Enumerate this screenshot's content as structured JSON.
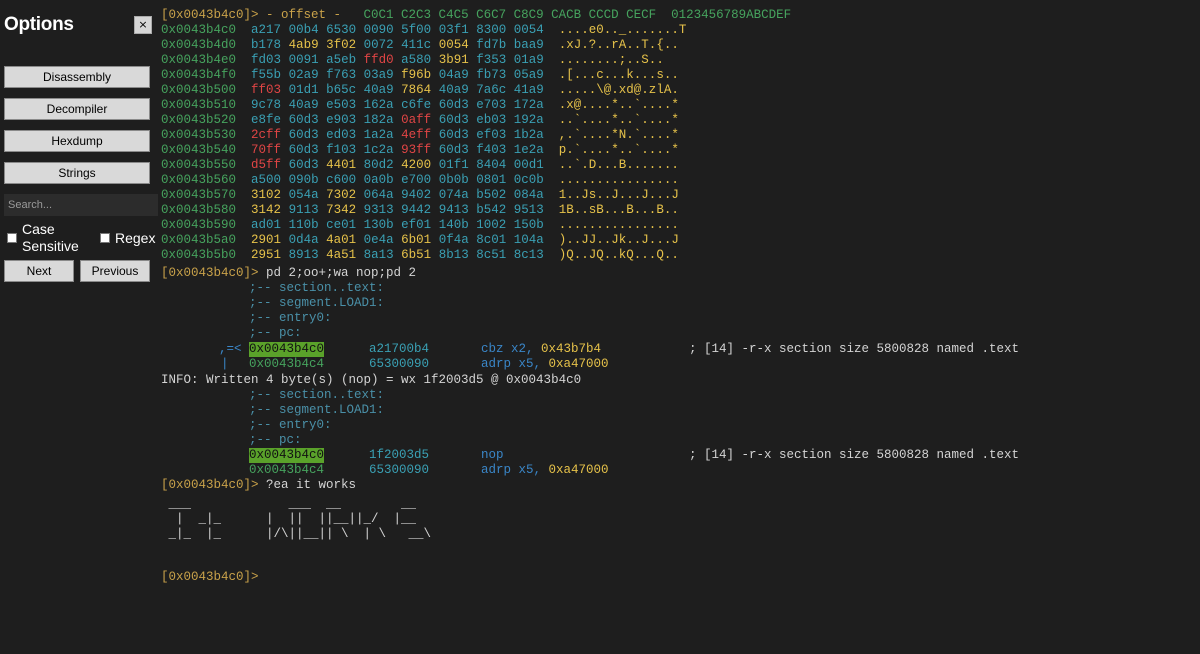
{
  "sidebar": {
    "title": "Options",
    "close_label": "×",
    "buttons": {
      "disassembly": "Disassembly",
      "decompiler": "Decompiler",
      "hexdump": "Hexdump",
      "strings": "Strings"
    },
    "search_placeholder": "Search...",
    "case_sensitive_line1": "Case",
    "case_sensitive_line2": "Sensitive",
    "regex": "Regex",
    "next": "Next",
    "previous": "Previous"
  },
  "terminal": {
    "hex_header": {
      "prompt": "[0x0043b4c0]>",
      "dash_offset": " - offset - ",
      "cols": "  C0C1 C2C3 C4C5 C6C7 C8C9 CACB CCCD CECF",
      "ascii_cols": "  0123456789ABCDEF"
    },
    "hex_rows": [
      {
        "addr": "0x0043b4c0",
        "w": [
          [
            "a217",
            "x"
          ],
          [
            "00b4",
            "m"
          ],
          [
            "6530",
            "x"
          ],
          [
            "0090",
            "x"
          ],
          [
            "5f00",
            "m"
          ],
          [
            "03f1",
            "x"
          ],
          [
            "8300",
            "x"
          ],
          [
            "0054",
            "m"
          ]
        ],
        "ascii": "....e0.._.......T"
      },
      {
        "addr": "0x0043b4d0",
        "w": [
          [
            "b178",
            "x"
          ],
          [
            "4ab9",
            "y"
          ],
          [
            "3f02",
            "y"
          ],
          [
            "0072",
            "x"
          ],
          [
            "411c",
            "x"
          ],
          [
            "0054",
            "y"
          ],
          [
            "fd7b",
            "x"
          ],
          [
            "baa9",
            "x"
          ]
        ],
        "ascii": ".xJ.?..rA..T.{.."
      },
      {
        "addr": "0x0043b4e0",
        "w": [
          [
            "fd03",
            "x"
          ],
          [
            "0091",
            "x"
          ],
          [
            "a5eb",
            "x"
          ],
          [
            "ffd0",
            "r"
          ],
          [
            "a580",
            "x"
          ],
          [
            "3b91",
            "y"
          ],
          [
            "f353",
            "x"
          ],
          [
            "01a9",
            "x"
          ]
        ],
        "ascii": "........;..S.."
      },
      {
        "addr": "0x0043b4f0",
        "w": [
          [
            "f55b",
            "x"
          ],
          [
            "02a9",
            "x"
          ],
          [
            "f763",
            "x"
          ],
          [
            "03a9",
            "x"
          ],
          [
            "f96b",
            "y"
          ],
          [
            "04a9",
            "x"
          ],
          [
            "fb73",
            "x"
          ],
          [
            "05a9",
            "x"
          ]
        ],
        "ascii": ".[...c...k...s.."
      },
      {
        "addr": "0x0043b500",
        "w": [
          [
            "ff03",
            "r"
          ],
          [
            "01d1",
            "x"
          ],
          [
            "b65c",
            "x"
          ],
          [
            "40a9",
            "x"
          ],
          [
            "7864",
            "y"
          ],
          [
            "40a9",
            "x"
          ],
          [
            "7a6c",
            "x"
          ],
          [
            "41a9",
            "x"
          ]
        ],
        "ascii": ".....\\@.xd@.zlA."
      },
      {
        "addr": "0x0043b510",
        "w": [
          [
            "9c78",
            "x"
          ],
          [
            "40a9",
            "x"
          ],
          [
            "e503",
            "x"
          ],
          [
            "162a",
            "x"
          ],
          [
            "c6fe",
            "x"
          ],
          [
            "60d3",
            "x"
          ],
          [
            "e703",
            "x"
          ],
          [
            "172a",
            "x"
          ]
        ],
        "ascii": ".x@....*..`....*"
      },
      {
        "addr": "0x0043b520",
        "w": [
          [
            "e8fe",
            "x"
          ],
          [
            "60d3",
            "x"
          ],
          [
            "e903",
            "x"
          ],
          [
            "182a",
            "x"
          ],
          [
            "0aff",
            "r"
          ],
          [
            "60d3",
            "x"
          ],
          [
            "eb03",
            "x"
          ],
          [
            "192a",
            "x"
          ]
        ],
        "ascii": "..`....*..`....*"
      },
      {
        "addr": "0x0043b530",
        "w": [
          [
            "2cff",
            "r"
          ],
          [
            "60d3",
            "x"
          ],
          [
            "ed03",
            "x"
          ],
          [
            "1a2a",
            "x"
          ],
          [
            "4eff",
            "r"
          ],
          [
            "60d3",
            "x"
          ],
          [
            "ef03",
            "x"
          ],
          [
            "1b2a",
            "x"
          ]
        ],
        "ascii": ",.`....*N.`....*"
      },
      {
        "addr": "0x0043b540",
        "w": [
          [
            "70ff",
            "r"
          ],
          [
            "60d3",
            "x"
          ],
          [
            "f103",
            "x"
          ],
          [
            "1c2a",
            "x"
          ],
          [
            "93ff",
            "r"
          ],
          [
            "60d3",
            "x"
          ],
          [
            "f403",
            "x"
          ],
          [
            "1e2a",
            "x"
          ]
        ],
        "ascii": "p.`....*..`....*"
      },
      {
        "addr": "0x0043b550",
        "w": [
          [
            "d5ff",
            "r"
          ],
          [
            "60d3",
            "x"
          ],
          [
            "4401",
            "y"
          ],
          [
            "80d2",
            "x"
          ],
          [
            "4200",
            "y"
          ],
          [
            "01f1",
            "x"
          ],
          [
            "8404",
            "x"
          ],
          [
            "00d1",
            "x"
          ]
        ],
        "ascii": "..`.D...B......."
      },
      {
        "addr": "0x0043b560",
        "w": [
          [
            "a500",
            "x"
          ],
          [
            "090b",
            "x"
          ],
          [
            "c600",
            "x"
          ],
          [
            "0a0b",
            "x"
          ],
          [
            "e700",
            "x"
          ],
          [
            "0b0b",
            "x"
          ],
          [
            "0801",
            "x"
          ],
          [
            "0c0b",
            "x"
          ]
        ],
        "ascii": "................"
      },
      {
        "addr": "0x0043b570",
        "w": [
          [
            "3102",
            "y"
          ],
          [
            "054a",
            "x"
          ],
          [
            "7302",
            "y"
          ],
          [
            "064a",
            "x"
          ],
          [
            "9402",
            "x"
          ],
          [
            "074a",
            "x"
          ],
          [
            "b502",
            "x"
          ],
          [
            "084a",
            "x"
          ]
        ],
        "ascii": "1..Js..J...J...J"
      },
      {
        "addr": "0x0043b580",
        "w": [
          [
            "3142",
            "y"
          ],
          [
            "9113",
            "x"
          ],
          [
            "7342",
            "y"
          ],
          [
            "9313",
            "x"
          ],
          [
            "9442",
            "x"
          ],
          [
            "9413",
            "x"
          ],
          [
            "b542",
            "x"
          ],
          [
            "9513",
            "x"
          ]
        ],
        "ascii": "1B..sB...B...B.."
      },
      {
        "addr": "0x0043b590",
        "w": [
          [
            "ad01",
            "x"
          ],
          [
            "110b",
            "x"
          ],
          [
            "ce01",
            "x"
          ],
          [
            "130b",
            "x"
          ],
          [
            "ef01",
            "x"
          ],
          [
            "140b",
            "x"
          ],
          [
            "1002",
            "x"
          ],
          [
            "150b",
            "x"
          ]
        ],
        "ascii": "................"
      },
      {
        "addr": "0x0043b5a0",
        "w": [
          [
            "2901",
            "y"
          ],
          [
            "0d4a",
            "x"
          ],
          [
            "4a01",
            "y"
          ],
          [
            "0e4a",
            "x"
          ],
          [
            "6b01",
            "y"
          ],
          [
            "0f4a",
            "x"
          ],
          [
            "8c01",
            "x"
          ],
          [
            "104a",
            "x"
          ]
        ],
        "ascii": ")..JJ..Jk..J...J"
      },
      {
        "addr": "0x0043b5b0",
        "w": [
          [
            "2951",
            "y"
          ],
          [
            "8913",
            "x"
          ],
          [
            "4a51",
            "y"
          ],
          [
            "8a13",
            "x"
          ],
          [
            "6b51",
            "y"
          ],
          [
            "8b13",
            "x"
          ],
          [
            "8c51",
            "x"
          ],
          [
            "8c13",
            "x"
          ]
        ],
        "ascii": ")Q..JQ..kQ...Q.."
      }
    ],
    "cmd1_prompt": "[0x0043b4c0]>",
    "cmd1": " pd 2;oo+;wa nop;pd 2",
    "block1": {
      "comments": [
        ";-- section..text:",
        ";-- segment.LOAD1:",
        ";-- entry0:",
        ";-- pc:"
      ],
      "arrow1": ",=<",
      "arrow2": "|",
      "row1": {
        "addr": "0x0043b4c0",
        "bytes": "a21700b4",
        "op": "cbz x2, ",
        "arg": "0x43b7b4",
        "comment": "; [14] -r-x section size 5800828 named .text"
      },
      "row2": {
        "addr": "0x0043b4c4",
        "bytes": "65300090",
        "op": "adrp x5, ",
        "arg": "0xa47000"
      }
    },
    "info": "INFO: Written 4 byte(s) (nop) = wx 1f2003d5 @ 0x0043b4c0",
    "block2": {
      "comments": [
        ";-- section..text:",
        ";-- segment.LOAD1:",
        ";-- entry0:",
        ";-- pc:"
      ],
      "row1": {
        "addr": "0x0043b4c0",
        "bytes": "1f2003d5",
        "op": "nop",
        "comment": "; [14] -r-x section size 5800828 named .text"
      },
      "row2": {
        "addr": "0x0043b4c4",
        "bytes": "65300090",
        "op": "adrp x5, ",
        "arg": "0xa47000"
      }
    },
    "cmd2_prompt": "[0x0043b4c0]>",
    "cmd2": " ?ea it works",
    "ascii_art": [
      " ___             ___  __        __",
      "  |  _|_      |  ||  ||__||_/  |__",
      " _|_  |_      |/\\||__|| \\  | \\   __\\"
    ],
    "final_prompt": "[0x0043b4c0]>"
  }
}
